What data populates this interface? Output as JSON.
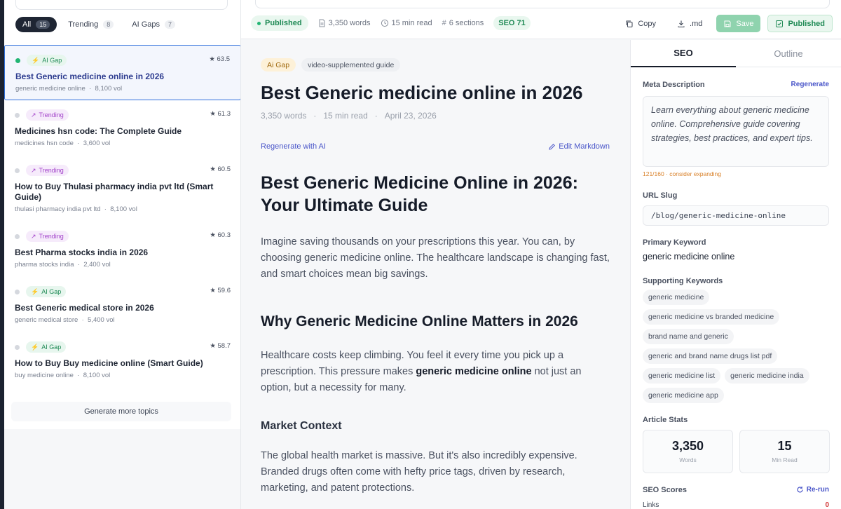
{
  "sidebar": {
    "filters": [
      {
        "label": "All",
        "count": "15"
      },
      {
        "label": "Trending",
        "count": "8"
      },
      {
        "label": "AI Gaps",
        "count": "7"
      }
    ],
    "topics": [
      {
        "badge": "AI Gap",
        "kind": "ai",
        "score": "★ 63.5",
        "title": "Best Generic medicine online in 2026",
        "keyword": "generic medicine online",
        "volume": "8,100 vol"
      },
      {
        "badge": "Trending",
        "kind": "trend",
        "score": "★ 61.3",
        "title": "Medicines hsn code: The Complete Guide",
        "keyword": "medicines hsn code",
        "volume": "3,600 vol"
      },
      {
        "badge": "Trending",
        "kind": "trend",
        "score": "★ 60.5",
        "title": "How to Buy Thulasi pharmacy india pvt ltd (Smart Guide)",
        "keyword": "thulasi pharmacy india pvt ltd",
        "volume": "8,100 vol"
      },
      {
        "badge": "Trending",
        "kind": "trend",
        "score": "★ 60.3",
        "title": "Best Pharma stocks india in 2026",
        "keyword": "pharma stocks india",
        "volume": "2,400 vol"
      },
      {
        "badge": "AI Gap",
        "kind": "ai",
        "score": "★ 59.6",
        "title": "Best Generic medical store in 2026",
        "keyword": "generic medical store",
        "volume": "5,400 vol"
      },
      {
        "badge": "AI Gap",
        "kind": "ai",
        "score": "★ 58.7",
        "title": "How to Buy Buy medicine online (Smart Guide)",
        "keyword": "buy medicine online",
        "volume": "8,100 vol"
      }
    ],
    "generate_more": "Generate more topics"
  },
  "toolbar": {
    "status": "Published",
    "words": "3,350 words",
    "read_time": "15 min read",
    "sections": "6 sections",
    "seo": "SEO 71",
    "copy": "Copy",
    "md": ".md",
    "save": "Save",
    "published": "Published"
  },
  "article": {
    "tag_ai": "Ai Gap",
    "tag_type": "video-supplemented guide",
    "title": "Best Generic medicine online in 2026",
    "meta_words": "3,350 words",
    "meta_read": "15 min read",
    "meta_date": "April 23, 2026",
    "regenerate": "Regenerate with AI",
    "edit_markdown": "Edit Markdown",
    "h1": "Best Generic Medicine Online in 2026: Your Ultimate Guide",
    "p1": "Imagine saving thousands on your prescriptions this year. You can, by choosing generic medicine online. The healthcare landscape is changing fast, and smart choices mean big savings.",
    "h2": "Why Generic Medicine Online Matters in 2026",
    "p2_before": "Healthcare costs keep climbing. You feel it every time you pick up a prescription. This pressure makes ",
    "p2_bold": "generic medicine online",
    "p2_after": " not just an option, but a necessity for many.",
    "h3": "Market Context",
    "p3": "The global health market is massive. But it's also incredibly expensive. Branded drugs often come with hefty price tags, driven by research, marketing, and patent protections."
  },
  "panel": {
    "tabs": [
      "SEO",
      "Outline"
    ],
    "meta_label": "Meta Description",
    "regenerate": "Regenerate",
    "meta_text": "Learn everything about generic medicine online. Comprehensive guide covering strategies, best practices, and expert tips.",
    "meta_counter": "121/160 · consider expanding",
    "slug_label": "URL Slug",
    "slug": "/blog/generic-medicine-online",
    "primary_label": "Primary Keyword",
    "primary": "generic medicine online",
    "supporting_label": "Supporting Keywords",
    "supporting": [
      "generic medicine",
      "generic medicine vs branded medicine",
      "brand name and generic",
      "generic and brand name drugs list pdf",
      "generic medicine list",
      "generic medicine india",
      "generic medicine app"
    ],
    "stats_label": "Article Stats",
    "stats": [
      {
        "value": "3,350",
        "label": "Words"
      },
      {
        "value": "15",
        "label": "Min Read"
      }
    ],
    "scores_label": "SEO Scores",
    "rerun": "Re-run",
    "links_label": "Links",
    "links_value": "0"
  },
  "colors": {
    "accent": "#2f6fdc",
    "green": "#1f8a55",
    "link": "#4a56c9",
    "dark": "#161c29"
  }
}
